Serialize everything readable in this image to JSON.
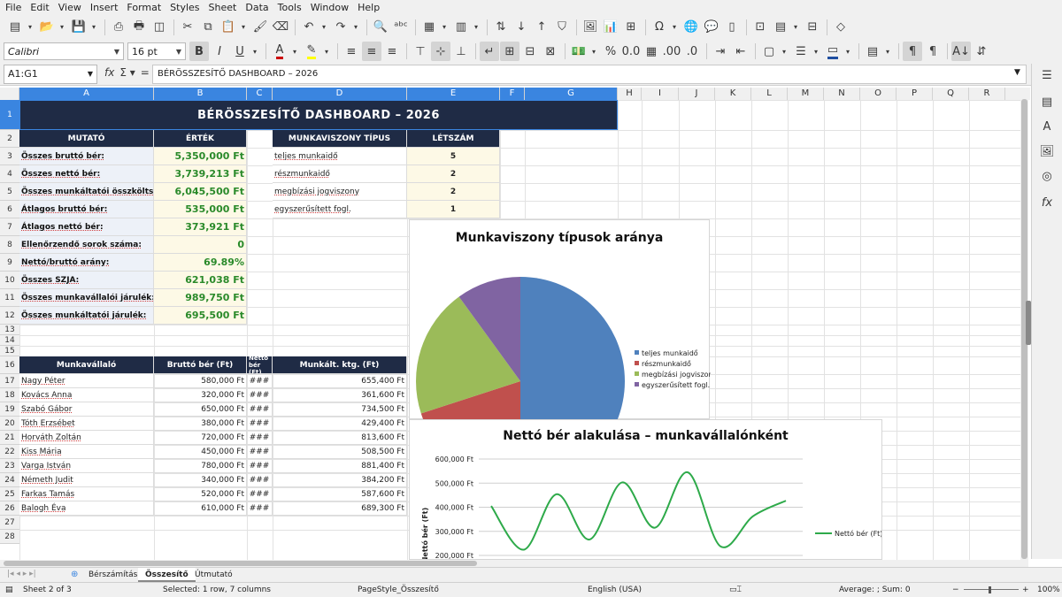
{
  "menu": [
    "File",
    "Edit",
    "View",
    "Insert",
    "Format",
    "Styles",
    "Sheet",
    "Data",
    "Tools",
    "Window",
    "Help"
  ],
  "font": {
    "name": "Calibri",
    "size": "16 pt"
  },
  "namebox": "A1:G1",
  "formula": "BÉRÖSSZESÍTŐ DASHBOARD – 2026",
  "columns": [
    "A",
    "B",
    "C",
    "D",
    "E",
    "F",
    "G",
    "H",
    "I",
    "J",
    "K",
    "L",
    "M",
    "N",
    "O",
    "P",
    "Q",
    "R"
  ],
  "rows": [
    "1",
    "2",
    "3",
    "4",
    "5",
    "6",
    "7",
    "8",
    "9",
    "10",
    "11",
    "12",
    "13",
    "14",
    "15",
    "16",
    "17",
    "18",
    "19",
    "20",
    "21",
    "22",
    "23",
    "24",
    "25",
    "26",
    "27",
    "28"
  ],
  "title": "BÉRÖSSZESÍTŐ DASHBOARD – 2026",
  "summary": {
    "h_metric": "MUTATÓ",
    "h_value": "ÉRTÉK",
    "items": [
      {
        "label": "Összes bruttó bér:",
        "value": "5,350,000 Ft"
      },
      {
        "label": "Összes nettó bér:",
        "value": "3,739,213 Ft"
      },
      {
        "label": "Összes munkáltatói összköltség:",
        "value": "6,045,500 Ft"
      },
      {
        "label": "Átlagos bruttó bér:",
        "value": "535,000 Ft"
      },
      {
        "label": "Átlagos nettó bér:",
        "value": "373,921 Ft"
      },
      {
        "label": "Ellenőrzendő sorok száma:",
        "value": "0"
      },
      {
        "label": "Nettó/bruttó arány:",
        "value": "69.89%"
      },
      {
        "label": "Összes SZJA:",
        "value": "621,038 Ft"
      },
      {
        "label": "Összes munkavállalói járulék:",
        "value": "989,750 Ft"
      },
      {
        "label": "Összes munkáltatói járulék:",
        "value": "695,500 Ft"
      }
    ]
  },
  "types": {
    "h_type": "MUNKAVISZONY TÍPUS",
    "h_count": "LÉTSZÁM",
    "items": [
      {
        "type": "teljes munkaidő",
        "count": "5"
      },
      {
        "type": "részmunkaidő",
        "count": "2"
      },
      {
        "type": "megbízási jogviszony",
        "count": "2"
      },
      {
        "type": "egyszerűsített fogl.",
        "count": "1"
      }
    ]
  },
  "employees": {
    "h_name": "Munkavállaló",
    "h_gross": "Bruttó bér (Ft)",
    "h_net": "Nettó bér (Ft)",
    "h_cost": "Munkált. ktg. (Ft)",
    "overflow": "###",
    "items": [
      {
        "name": "Nagy Péter",
        "gross": "580,000 Ft",
        "cost": "655,400 Ft"
      },
      {
        "name": "Kovács Anna",
        "gross": "320,000 Ft",
        "cost": "361,600 Ft"
      },
      {
        "name": "Szabó Gábor",
        "gross": "650,000 Ft",
        "cost": "734,500 Ft"
      },
      {
        "name": "Tóth Erzsébet",
        "gross": "380,000 Ft",
        "cost": "429,400 Ft"
      },
      {
        "name": "Horváth Zoltán",
        "gross": "720,000 Ft",
        "cost": "813,600 Ft"
      },
      {
        "name": "Kiss Mária",
        "gross": "450,000 Ft",
        "cost": "508,500 Ft"
      },
      {
        "name": "Varga István",
        "gross": "780,000 Ft",
        "cost": "881,400 Ft"
      },
      {
        "name": "Németh Judit",
        "gross": "340,000 Ft",
        "cost": "384,200 Ft"
      },
      {
        "name": "Farkas Tamás",
        "gross": "520,000 Ft",
        "cost": "587,600 Ft"
      },
      {
        "name": "Balogh Éva",
        "gross": "610,000 Ft",
        "cost": "689,300 Ft"
      }
    ]
  },
  "chart_data": [
    {
      "type": "pie",
      "title": "Munkaviszony típusok aránya",
      "categories": [
        "teljes munkaidő",
        "részmunkaidő",
        "megbízási jogviszony",
        "egyszerűsített fogl."
      ],
      "values": [
        5,
        2,
        2,
        1
      ],
      "colors": [
        "#4f81bd",
        "#c0504d",
        "#9bbb59",
        "#8064a2"
      ],
      "legend": "right"
    },
    {
      "type": "line",
      "title": "Nettó bér alakulása – munkavállalónként",
      "ylabel": "Nettó bér (Ft)",
      "yticks": [
        "600,000 Ft",
        "500,000 Ft",
        "400,000 Ft",
        "300,000 Ft",
        "200,000 Ft"
      ],
      "ylim": [
        200000,
        600000
      ],
      "series": [
        {
          "name": "Nettó bér (Ft)",
          "values": [
            405000,
            224000,
            454000,
            266000,
            503000,
            315000,
            545000,
            238000,
            363000,
            427000
          ],
          "color": "#2eaa4a"
        }
      ],
      "legend": "right"
    }
  ],
  "tabs": [
    "Bérszámítás",
    "Összesítő",
    "Útmutató"
  ],
  "status": {
    "sheet": "Sheet 2 of 3",
    "selection": "Selected: 1 row, 7 columns",
    "pagestyle": "PageStyle_Összesítő",
    "lang": "English (USA)",
    "sum": "Average: ; Sum: 0",
    "zoom": "100%"
  }
}
